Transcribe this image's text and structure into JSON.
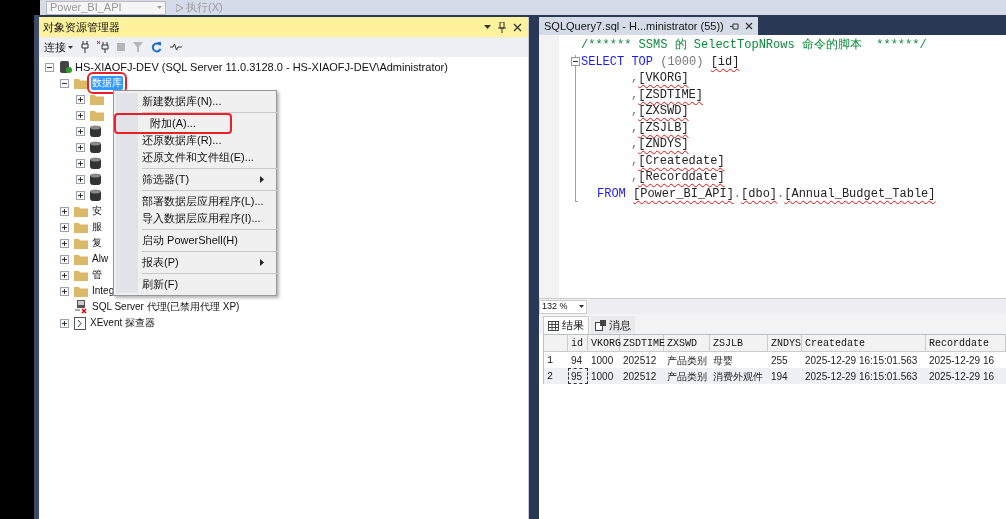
{
  "toolbar": {
    "database": "Power_BI_API",
    "execute": "执行(X)"
  },
  "explorer": {
    "title": "对象资源管理器",
    "connect": "连接",
    "server": {
      "label": "HS-XIAOFJ-DEV (SQL Server 11.0.3128.0 - HS-XIAOFJ-DEV\\Administrator)",
      "expanded": true
    },
    "nodes": [
      {
        "label": "数据库",
        "kind": "folder",
        "expanded": true,
        "selected": true,
        "annotated": true,
        "children": [
          {
            "kind": "folder",
            "expanded": false
          },
          {
            "kind": "folder",
            "expanded": false
          },
          {
            "kind": "database",
            "expanded": false
          },
          {
            "kind": "database",
            "expanded": false
          },
          {
            "kind": "database",
            "expanded": false
          },
          {
            "kind": "database",
            "expanded": false
          },
          {
            "kind": "database",
            "expanded": false
          }
        ]
      },
      {
        "label": "安",
        "kind": "folder",
        "expanded": false,
        "selected": false,
        "annotated": false
      },
      {
        "label": "服",
        "kind": "folder",
        "expanded": false,
        "selected": false,
        "annotated": false
      },
      {
        "label": "复",
        "kind": "folder",
        "expanded": false,
        "selected": false,
        "annotated": false
      },
      {
        "label": "Alw",
        "kind": "folder",
        "expanded": false,
        "selected": false,
        "annotated": false
      },
      {
        "label": "管",
        "kind": "folder",
        "expanded": false,
        "selected": false,
        "annotated": false
      },
      {
        "label": "Integ",
        "kind": "folder",
        "expanded": false,
        "selected": false,
        "annotated": false
      },
      {
        "label": "SQL Server 代理(已禁用代理 XP)",
        "kind": "agent",
        "selected": false,
        "annotated": false
      },
      {
        "label": "XEvent 探查器",
        "kind": "xevent",
        "expanded": false,
        "selected": false,
        "annotated": false
      }
    ]
  },
  "context_menu": [
    {
      "kind": "item",
      "label": "新建数据库(N)...",
      "submenu": false,
      "annotated": false
    },
    {
      "kind": "separator"
    },
    {
      "kind": "item",
      "label": "附加(A)...",
      "submenu": false,
      "annotated": true
    },
    {
      "kind": "item",
      "label": "还原数据库(R)...",
      "submenu": false,
      "annotated": false
    },
    {
      "kind": "item",
      "label": "还原文件和文件组(E)...",
      "submenu": false,
      "annotated": false
    },
    {
      "kind": "separator"
    },
    {
      "kind": "item",
      "label": "筛选器(T)",
      "submenu": true,
      "annotated": false
    },
    {
      "kind": "separator"
    },
    {
      "kind": "item",
      "label": "部署数据层应用程序(L)...",
      "submenu": false,
      "annotated": false
    },
    {
      "kind": "item",
      "label": "导入数据层应用程序(I)...",
      "submenu": false,
      "annotated": false
    },
    {
      "kind": "separator"
    },
    {
      "kind": "item",
      "label": "启动 PowerShell(H)",
      "submenu": false,
      "annotated": false
    },
    {
      "kind": "separator"
    },
    {
      "kind": "item",
      "label": "报表(P)",
      "submenu": true,
      "annotated": false
    },
    {
      "kind": "separator"
    },
    {
      "kind": "item",
      "label": "刷新(F)",
      "submenu": false,
      "annotated": false
    }
  ],
  "editor": {
    "tab": "SQLQuery7.sql - H...ministrator (55))",
    "lines": [
      {
        "kind": "plain",
        "tokens": [
          {
            "kind": "comment",
            "text": "/****** SSMS 的 SelectTopNRows 命令的脚本  ******/"
          }
        ]
      },
      {
        "kind": "plain",
        "tokens": [
          {
            "kind": "keyword",
            "text": "SELECT TOP "
          },
          {
            "kind": "punct",
            "text": "(1000) "
          },
          {
            "kind": "ident",
            "text": "[id]"
          }
        ]
      },
      {
        "kind": "column",
        "tokens": [
          {
            "kind": "punct",
            "text": ","
          },
          {
            "kind": "ident",
            "text": "[VKORG]"
          }
        ]
      },
      {
        "kind": "column",
        "tokens": [
          {
            "kind": "punct",
            "text": ","
          },
          {
            "kind": "ident",
            "text": "[ZSDTIME]"
          }
        ]
      },
      {
        "kind": "column",
        "tokens": [
          {
            "kind": "punct",
            "text": ","
          },
          {
            "kind": "ident",
            "text": "[ZXSWD]"
          }
        ]
      },
      {
        "kind": "column",
        "tokens": [
          {
            "kind": "punct",
            "text": ","
          },
          {
            "kind": "ident",
            "text": "[ZSJLB]"
          }
        ]
      },
      {
        "kind": "column",
        "tokens": [
          {
            "kind": "punct",
            "text": ","
          },
          {
            "kind": "ident",
            "text": "[ZNDYS]"
          }
        ]
      },
      {
        "kind": "column",
        "tokens": [
          {
            "kind": "punct",
            "text": ","
          },
          {
            "kind": "ident",
            "text": "[Createdate]"
          }
        ]
      },
      {
        "kind": "column",
        "tokens": [
          {
            "kind": "punct",
            "text": ","
          },
          {
            "kind": "ident",
            "text": "[Recorddate]"
          }
        ]
      },
      {
        "kind": "clause",
        "tokens": [
          {
            "kind": "keyword",
            "text": "FROM "
          },
          {
            "kind": "ident",
            "text": "[Power_BI_API]"
          },
          {
            "kind": "punct",
            "text": "."
          },
          {
            "kind": "ident",
            "text": "[dbo]"
          },
          {
            "kind": "punct",
            "text": "."
          },
          {
            "kind": "ident",
            "text": "[Annual_Budget_Table]"
          }
        ]
      }
    ]
  },
  "zoom": "132 %",
  "result_tabs": [
    {
      "label": "结果",
      "kind": "grid",
      "selected": true
    },
    {
      "label": "消息",
      "kind": "message",
      "selected": false
    }
  ],
  "grid": {
    "columns": [
      "id",
      "VKORG",
      "ZSDTIME",
      "ZXSWD",
      "ZSJLB",
      "ZNDYS",
      "Createdate",
      "Recorddate"
    ],
    "rows": [
      {
        "number": "1",
        "cells": [
          {
            "text": "94",
            "focused": false
          },
          {
            "text": "1000",
            "focused": false
          },
          {
            "text": "202512",
            "focused": false
          },
          {
            "text": "产品类别",
            "focused": false
          },
          {
            "text": "母婴",
            "focused": false
          },
          {
            "text": "255",
            "focused": false
          },
          {
            "text": "2025-12-29 16:15:01.563",
            "focused": false
          },
          {
            "text": "2025-12-29 16",
            "focused": false
          }
        ]
      },
      {
        "number": "2",
        "cells": [
          {
            "text": "95",
            "focused": true
          },
          {
            "text": "1000",
            "focused": false
          },
          {
            "text": "202512",
            "focused": false
          },
          {
            "text": "产品类别",
            "focused": false
          },
          {
            "text": "消费外观件",
            "focused": false
          },
          {
            "text": "194",
            "focused": false
          },
          {
            "text": "2025-12-29 16:15:01.563",
            "focused": false
          },
          {
            "text": "2025-12-29 16",
            "focused": false
          }
        ]
      }
    ]
  }
}
